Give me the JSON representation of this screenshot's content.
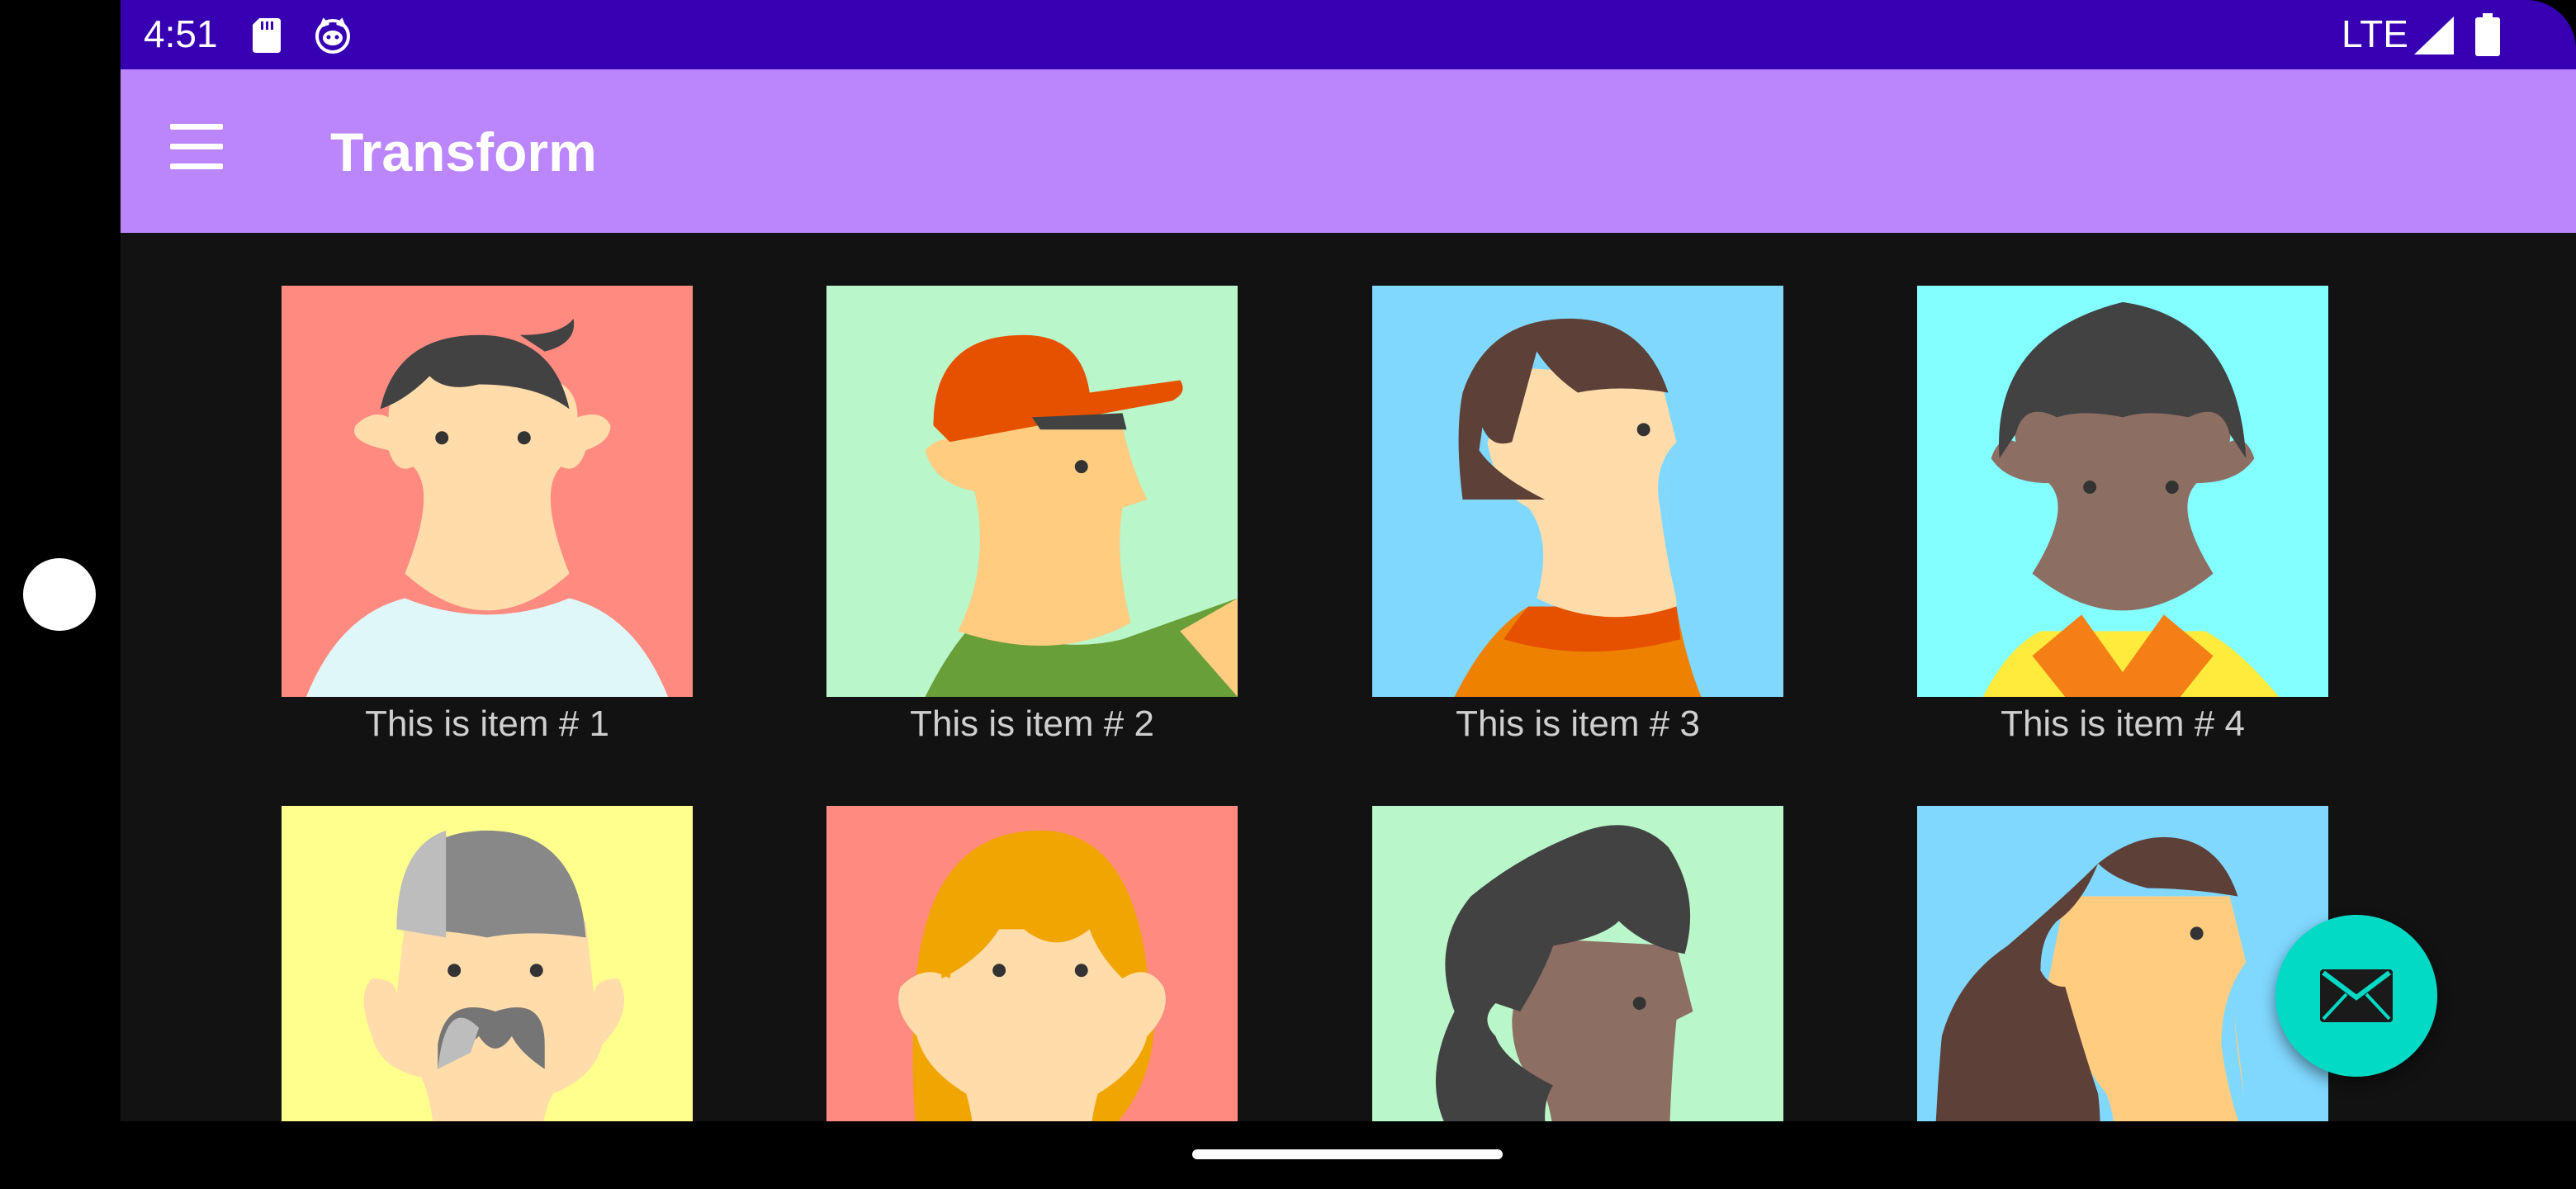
{
  "status_bar": {
    "time": "4:51",
    "network": "LTE",
    "icons": [
      "sd-card-icon",
      "cat-icon",
      "signal-icon",
      "battery-icon"
    ]
  },
  "app_bar": {
    "title": "Transform",
    "menu_icon": "menu-icon"
  },
  "items": [
    {
      "label": "This is item # 1",
      "bg": "#FF8A80"
    },
    {
      "label": "This is item # 2",
      "bg": "#B9F6CA"
    },
    {
      "label": "This is item # 3",
      "bg": "#80D8FF"
    },
    {
      "label": "This is item # 4",
      "bg": "#84FFFF"
    },
    {
      "label": "",
      "bg": "#FFFF8D"
    },
    {
      "label": "",
      "bg": "#FF8A80"
    },
    {
      "label": "",
      "bg": "#B9F6CA"
    },
    {
      "label": "",
      "bg": "#80D8FF"
    }
  ],
  "fab": {
    "icon": "mail-icon",
    "color": "#03DAC5"
  },
  "colors": {
    "status_bar": "#3700B3",
    "app_bar": "#BB86FC",
    "background": "#121212"
  }
}
